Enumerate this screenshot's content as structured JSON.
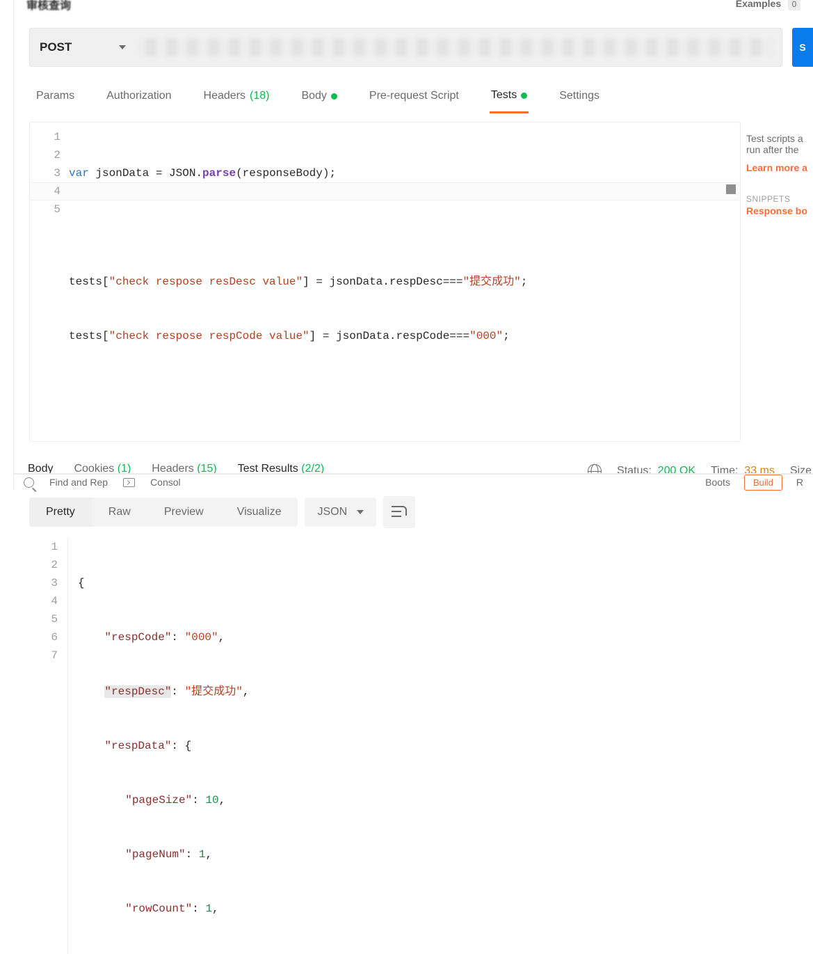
{
  "topTitle": "审核查询",
  "examplesLabel": "Examples",
  "examplesCount": "0",
  "httpMethod": "POST",
  "sendLabel": "S",
  "reqTabs": {
    "params": "Params",
    "auth": "Authorization",
    "headers": "Headers",
    "headersCount": "(18)",
    "body": "Body",
    "preReq": "Pre-request Script",
    "tests": "Tests",
    "settings": "Settings"
  },
  "testsCode": {
    "lines": [
      "1",
      "2",
      "3",
      "4",
      "5"
    ],
    "l1_var": "var",
    "l1_id": " jsonData ",
    "l1_eq": "= ",
    "l1_json": "JSON.",
    "l1_parse": "parse",
    "l1_args": "(responseBody);",
    "l3_a": "tests[",
    "l3_s": "\"check respose resDesc value\"",
    "l3_b": "] = jsonData.respDesc===",
    "l3_v": "\"提交成功\"",
    "l3_c": ";",
    "l4_a": "tests[",
    "l4_s": "\"check respose respCode value\"",
    "l4_b": "] = jsonData.respCode===",
    "l4_v": "\"000\"",
    "l4_c": ";"
  },
  "sideHelp": {
    "desc": "Test scripts are written in JavaScript, and are run after the response is received.",
    "descShort1": "Test scripts a",
    "descShort2": "run after the",
    "learn": "Learn more a",
    "snip": "SNIPPETS",
    "snipItem": "Response bo"
  },
  "respTabs": {
    "body": "Body",
    "cookies": "Cookies",
    "cookiesCount": "(1)",
    "headers": "Headers",
    "headersCount": "(15)",
    "testResults": "Test Results",
    "testCount": "(2/2)"
  },
  "respMeta": {
    "statusLabel": "Status:",
    "statusVal": "200 OK",
    "timeLabel": "Time:",
    "timeVal": "33 ms",
    "sizeLabel": "Size"
  },
  "fmtTabs": {
    "pretty": "Pretty",
    "raw": "Raw",
    "preview": "Preview",
    "visualize": "Visualize",
    "json": "JSON"
  },
  "respBody": {
    "lines": [
      "1",
      "2",
      "3",
      "4",
      "5",
      "6",
      "7"
    ],
    "l1": "{",
    "l2_k": "\"respCode\"",
    "l2_v": "\"000\"",
    "l3_k": "\"respDesc\"",
    "l3_v": "\"提交成功\"",
    "l4_k": "\"respData\"",
    "l4_v": "{",
    "l5_k": "\"pageSize\"",
    "l5_v": "10",
    "l6_k": "\"pageNum\"",
    "l6_v": "1",
    "l7_k": "\"rowCount\"",
    "l7_v": "1"
  },
  "footer": {
    "find": "Find and Rep",
    "console": "Consol",
    "boot": "Boots",
    "build": "Build",
    "runner": "R"
  }
}
